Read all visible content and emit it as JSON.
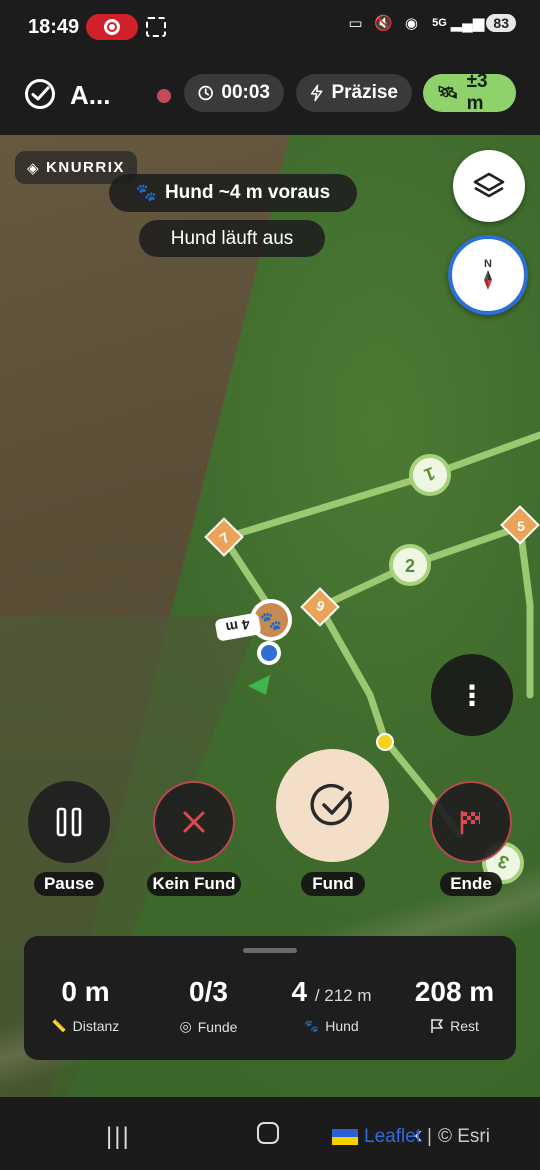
{
  "status_bar": {
    "time": "18:49",
    "network": "5G",
    "battery": "83"
  },
  "app_bar": {
    "title": "A...",
    "timer": "00:03",
    "precision_label": "Präzise",
    "gps_accuracy": "±3 m"
  },
  "map": {
    "brand": "KNURRIX",
    "banner_primary": "Hund ~4 m voraus",
    "banner_secondary": "Hund läuft aus",
    "dog_distance_label": "4 m",
    "waypoints": [
      "7",
      "1",
      "2",
      "6",
      "5",
      "3"
    ]
  },
  "actions": {
    "pause_label": "Pause",
    "no_find_label": "Kein Fund",
    "find_label": "Fund",
    "end_label": "Ende"
  },
  "stats": {
    "distance_value": "0 m",
    "distance_label": "Distanz",
    "finds_value": "0/3",
    "finds_label": "Funde",
    "dog_value": "4",
    "dog_total": "/ 212 m",
    "dog_label": "Hund",
    "rest_value": "208 m",
    "rest_label": "Rest"
  },
  "attribution": {
    "leaflet": "Leaflet",
    "separator": "|",
    "esri": "© Esri"
  },
  "colors": {
    "accent_green": "#8fd26a",
    "route": "#a6d27a",
    "marker_orange": "#e9a45a",
    "location_blue": "#2d6fd6",
    "find_button": "#f3dfc7",
    "danger": "#e0484f"
  }
}
